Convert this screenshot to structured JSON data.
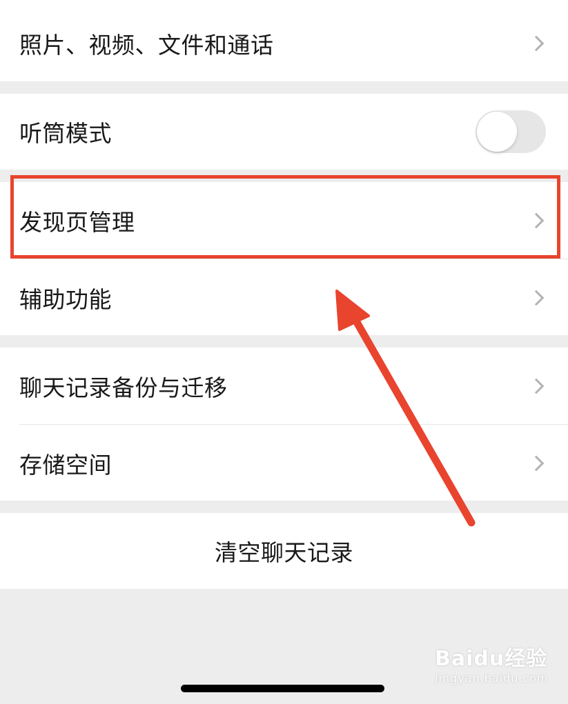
{
  "settings": {
    "media_row": {
      "label": "照片、视频、文件和通话"
    },
    "earpiece_row": {
      "label": "听筒模式",
      "toggle_on": false
    },
    "discover_row": {
      "label": "发现页管理"
    },
    "accessibility_row": {
      "label": "辅助功能"
    },
    "backup_row": {
      "label": "聊天记录备份与迁移"
    },
    "storage_row": {
      "label": "存储空间"
    },
    "clear_button": {
      "label": "清空聊天记录"
    }
  },
  "annotation": {
    "highlight_color": "#e8442e",
    "arrow_color": "#e8442e",
    "target": "发现页管理"
  },
  "watermark": {
    "brand": "Baidu经验",
    "url": "jingyan.baidu.com"
  }
}
